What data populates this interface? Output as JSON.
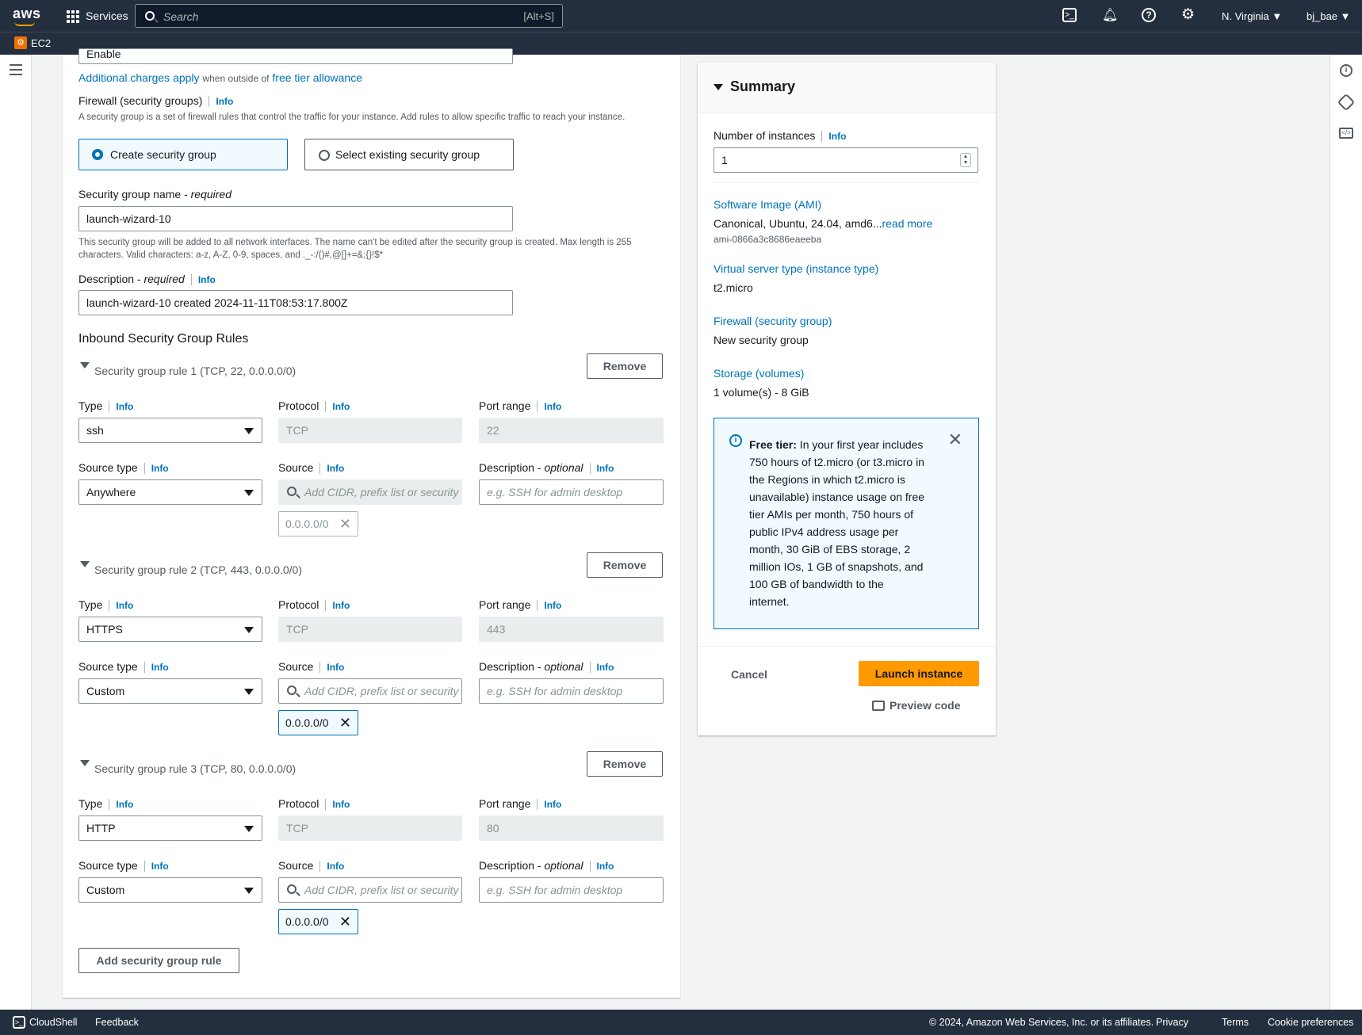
{
  "topnav": {
    "logo": "aws",
    "services_label": "Services",
    "search_placeholder": "Search",
    "search_shortcut": "[Alt+S]",
    "region": "N. Virginia",
    "user": "bj_bae",
    "service_name": "EC2"
  },
  "network": {
    "public_ip_value": "Enable",
    "charges_link": "Additional charges apply",
    "charges_text": "when outside of",
    "free_tier_link": "free tier allowance",
    "firewall_label": "Firewall (security groups)",
    "info": "Info",
    "firewall_desc": "A security group is a set of firewall rules that control the traffic for your instance. Add rules to allow specific traffic to reach your instance.",
    "create_sg": "Create security group",
    "select_sg": "Select existing security group",
    "sg_name_label": "Security group name - ",
    "required": "required",
    "sg_name_value": "launch-wizard-10",
    "sg_name_hint": "This security group will be added to all network interfaces. The name can't be edited after the security group is created. Max length is 255 characters. Valid characters: a-z, A-Z, 0-9, spaces, and ._-:/()#,@[]+=&;{}!$*",
    "desc_label": "Description - ",
    "desc_value": "launch-wizard-10 created 2024-11-11T08:53:17.800Z",
    "inbound_title": "Inbound Security Group Rules",
    "add_rule": "Add security group rule"
  },
  "labels": {
    "type": "Type",
    "protocol": "Protocol",
    "port_range": "Port range",
    "source_type": "Source type",
    "source": "Source",
    "description": "Description - ",
    "optional": "optional",
    "info": "Info",
    "remove": "Remove",
    "source_placeholder": "Add CIDR, prefix list or security",
    "desc_placeholder": "e.g. SSH for admin desktop"
  },
  "rules": [
    {
      "title": "Security group rule 1 (TCP, 22, 0.0.0.0/0)",
      "type": "ssh",
      "protocol": "TCP",
      "port": "22",
      "source_type": "Anywhere",
      "cidr": "0.0.0.0/0"
    },
    {
      "title": "Security group rule 2 (TCP, 443, 0.0.0.0/0)",
      "type": "HTTPS",
      "protocol": "TCP",
      "port": "443",
      "source_type": "Custom",
      "cidr": "0.0.0.0/0"
    },
    {
      "title": "Security group rule 3 (TCP, 80, 0.0.0.0/0)",
      "type": "HTTP",
      "protocol": "TCP",
      "port": "80",
      "source_type": "Custom",
      "cidr": "0.0.0.0/0"
    }
  ],
  "summary": {
    "title": "Summary",
    "num_instances_label": "Number of instances",
    "info": "Info",
    "num_instances_value": "1",
    "ami_label": "Software Image (AMI)",
    "ami_value": "Canonical, Ubuntu, 24.04, amd6...",
    "read_more": "read more",
    "ami_id": "ami-0866a3c8686eaeeba",
    "instance_type_label": "Virtual server type (instance type)",
    "instance_type_value": "t2.micro",
    "firewall_label": "Firewall (security group)",
    "firewall_value": "New security group",
    "storage_label": "Storage (volumes)",
    "storage_value": "1 volume(s) - 8 GiB",
    "free_tier_bold": "Free tier:",
    "free_tier_lines": [
      " In your first year includes",
      "750 hours of t2.micro (or t3.micro in",
      "the Regions in which t2.micro is",
      "unavailable) instance usage on free",
      "tier AMIs per month, 750 hours of",
      "public IPv4 address usage per",
      "month, 30 GiB of EBS storage, 2",
      "million IOs, 1 GB of snapshots, and",
      "100 GB of bandwidth to the",
      "internet."
    ],
    "cancel": "Cancel",
    "launch": "Launch instance",
    "preview_code": "Preview code"
  },
  "footer": {
    "cloudshell": "CloudShell",
    "feedback": "Feedback",
    "copyright": "© 2024, Amazon Web Services, Inc. or its affiliates.",
    "privacy": "Privacy",
    "terms": "Terms",
    "cookies": "Cookie preferences"
  },
  "colors": {
    "nav": "#232f3e",
    "link": "#0073bb",
    "launch": "#ff9900"
  }
}
